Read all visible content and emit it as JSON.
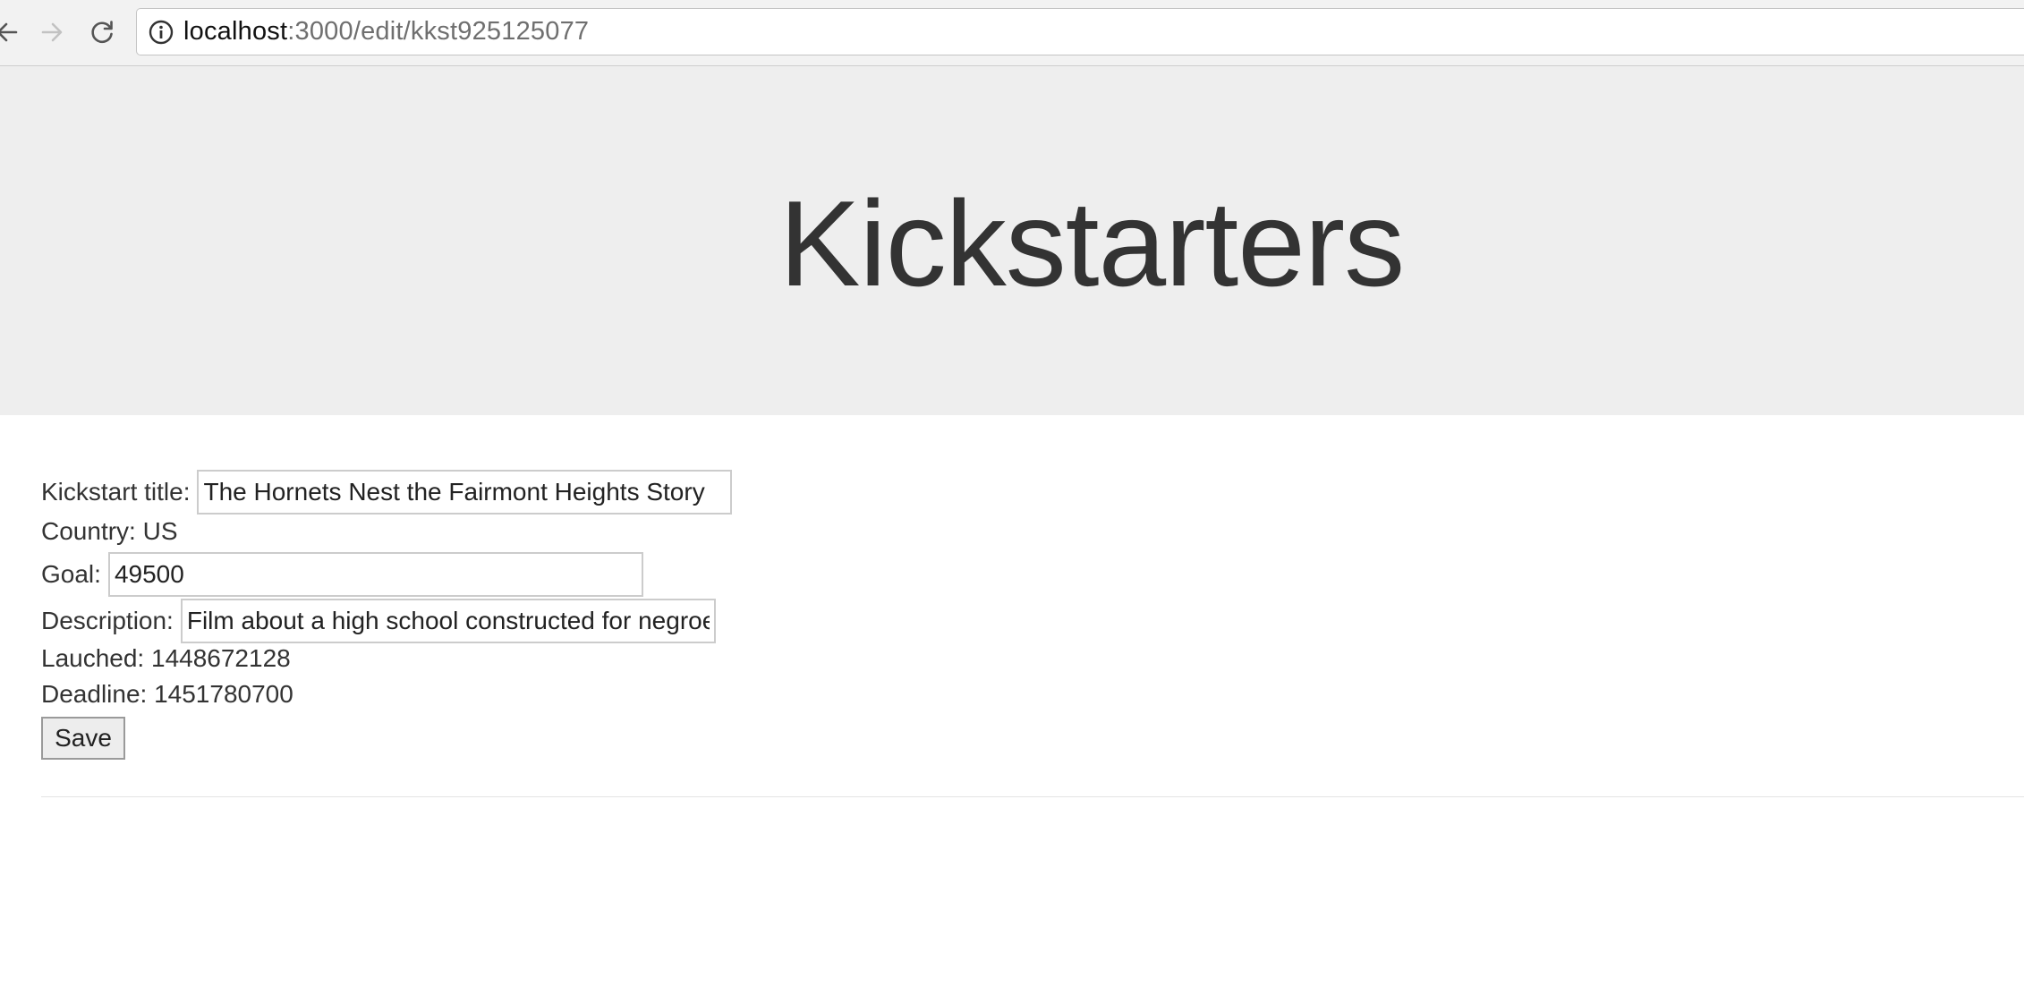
{
  "browser": {
    "url_host": "localhost",
    "url_path": ":3000/edit/kkst925125077",
    "icons": [
      "back-arrow-icon",
      "forward-arrow-icon",
      "reload-icon",
      "info-icon"
    ]
  },
  "header": {
    "title": "Kickstarters"
  },
  "form": {
    "title_label": "Kickstart title:",
    "title_value": "The Hornets Nest the Fairmont Heights Story",
    "country_label": "Country:",
    "country_value": "US",
    "goal_label": "Goal:",
    "goal_value": "49500",
    "description_label": "Description:",
    "description_value": "Film about a high school constructed for negroes",
    "launched_label": "Lauched:",
    "launched_value": "1448672128",
    "deadline_label": "Deadline:",
    "deadline_value": "1451780700",
    "save_label": "Save"
  }
}
